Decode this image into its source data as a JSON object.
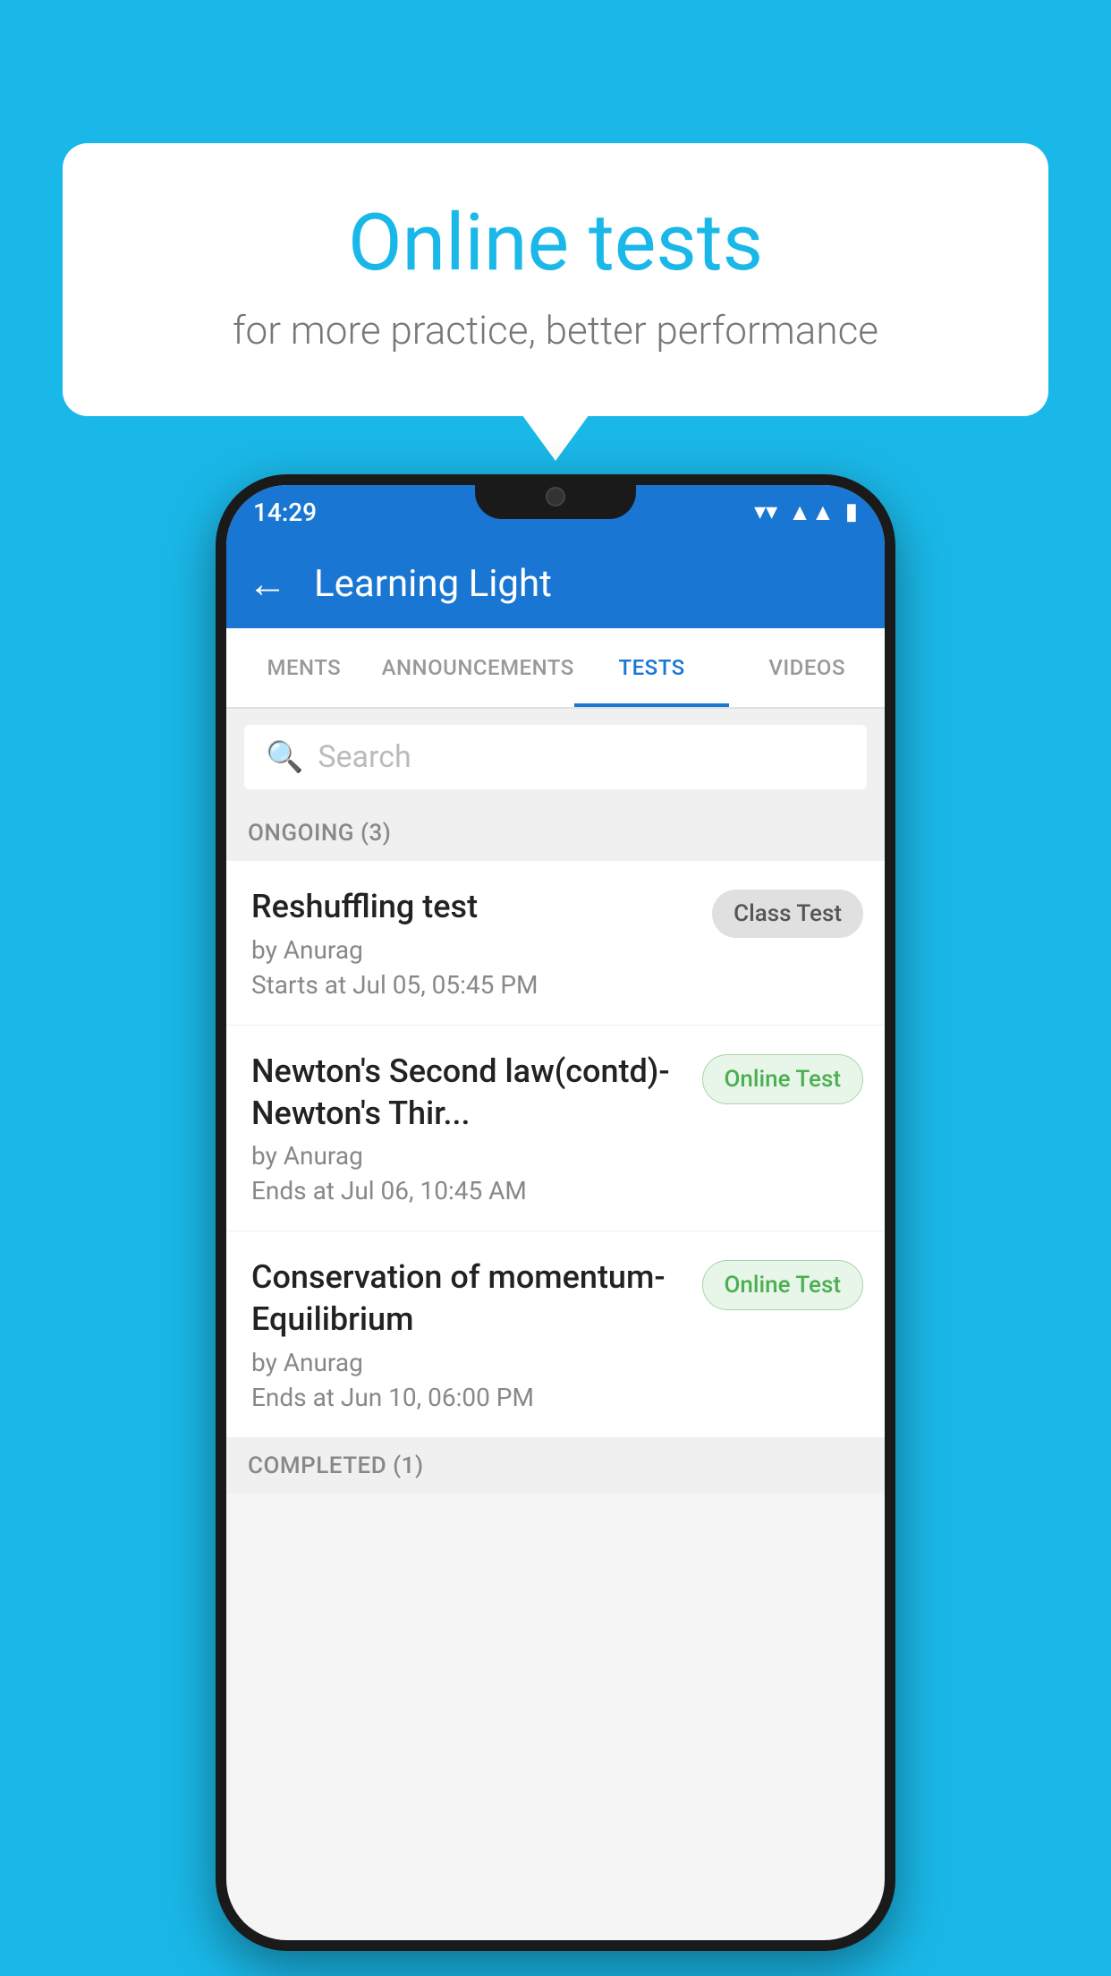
{
  "background_color": "#1ab8e8",
  "speech_bubble": {
    "title": "Online tests",
    "subtitle": "for more practice, better performance"
  },
  "phone": {
    "status_bar": {
      "time": "14:29",
      "icons": [
        "wifi",
        "signal",
        "battery"
      ]
    },
    "app_bar": {
      "title": "Learning Light",
      "back_label": "←"
    },
    "tabs": [
      {
        "label": "MENTS",
        "active": false
      },
      {
        "label": "ANNOUNCEMENTS",
        "active": false
      },
      {
        "label": "TESTS",
        "active": true
      },
      {
        "label": "VIDEOS",
        "active": false
      }
    ],
    "search": {
      "placeholder": "Search"
    },
    "sections": [
      {
        "header": "ONGOING (3)",
        "items": [
          {
            "title": "Reshuffling test",
            "author": "by Anurag",
            "date": "Starts at  Jul 05, 05:45 PM",
            "badge": "Class Test",
            "badge_type": "class"
          },
          {
            "title": "Newton's Second law(contd)-Newton's Thir...",
            "author": "by Anurag",
            "date": "Ends at  Jul 06, 10:45 AM",
            "badge": "Online Test",
            "badge_type": "online"
          },
          {
            "title": "Conservation of momentum-Equilibrium",
            "author": "by Anurag",
            "date": "Ends at  Jun 10, 06:00 PM",
            "badge": "Online Test",
            "badge_type": "online"
          }
        ]
      },
      {
        "header": "COMPLETED (1)",
        "items": []
      }
    ]
  }
}
